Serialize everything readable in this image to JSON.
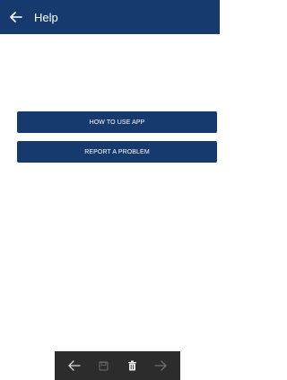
{
  "app_bar": {
    "title": "Help",
    "back_icon": "arrow-left-icon",
    "background": "#163a6e"
  },
  "menu": {
    "items": [
      {
        "label": "HOW TO USE APP"
      },
      {
        "label": "REPORT A PROBLEM"
      }
    ],
    "button_color": "#163a6e"
  },
  "toolbar": {
    "icons": [
      "arrow-left-icon",
      "save-icon",
      "trash-icon",
      "arrow-right-icon"
    ],
    "background": "#2c2c2c"
  }
}
